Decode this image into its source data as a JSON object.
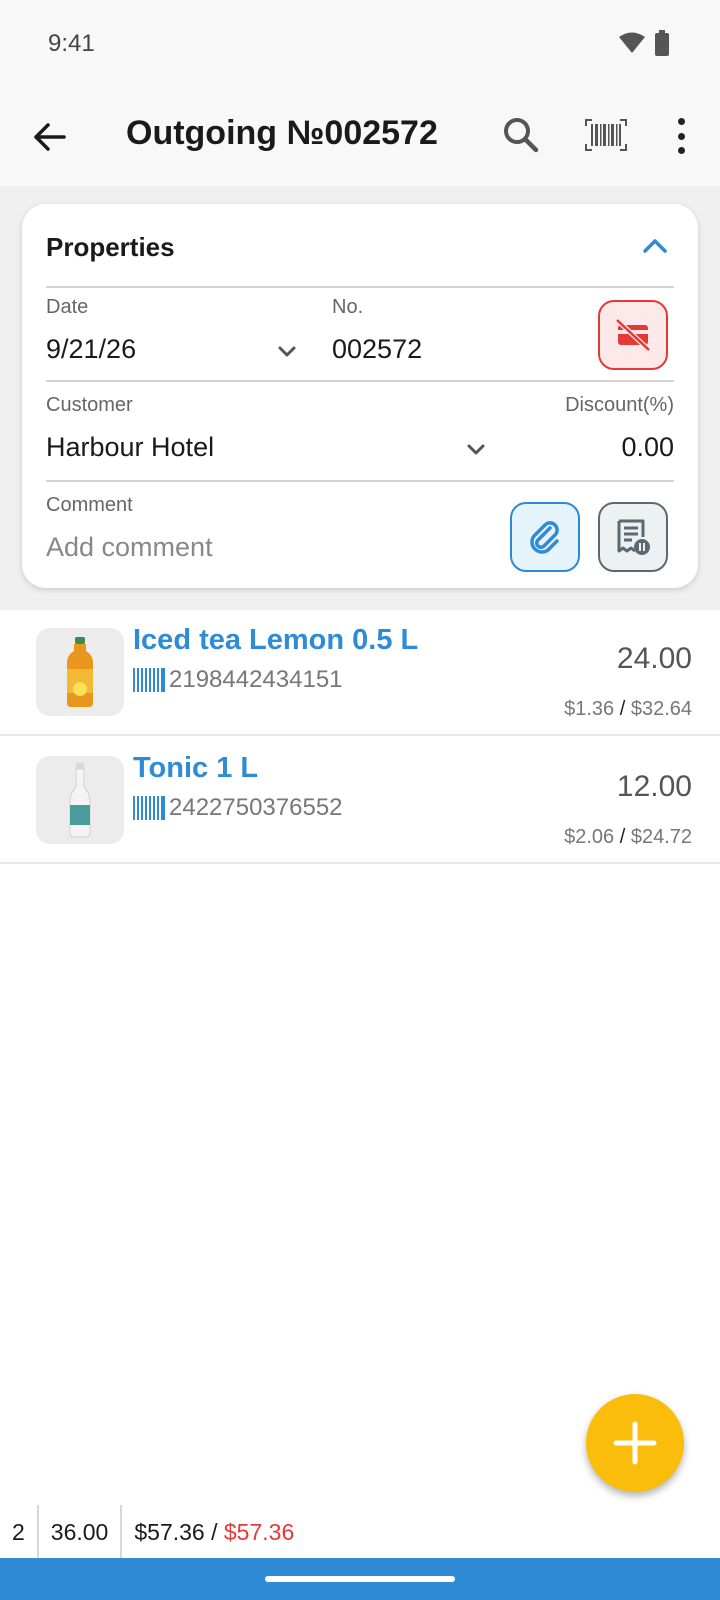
{
  "status_bar": {
    "time": "9:41",
    "icons": [
      "wifi-icon",
      "battery-icon"
    ]
  },
  "app_bar": {
    "title": "Outgoing №002572",
    "icons": [
      "back-arrow-icon",
      "search-icon",
      "barcode-scan-icon",
      "more-vert-icon"
    ]
  },
  "properties": {
    "title": "Properties",
    "date_label": "Date",
    "date_value": "9/21/26",
    "number_label": "No.",
    "number_value": "002572",
    "customer_label": "Customer",
    "customer_value": "Harbour Hotel",
    "discount_label": "Discount(%)",
    "discount_value": "0.00",
    "comment_label": "Comment",
    "comment_placeholder": "Add comment"
  },
  "items": [
    {
      "name": "Iced tea Lemon 0.5 L",
      "barcode": "2198442434151",
      "qty": "24.00",
      "unit_price": "$1.36",
      "total": "$32.64",
      "thumb_icon": "iced-tea-bottle-icon"
    },
    {
      "name": "Tonic 1 L",
      "barcode": "2422750376552",
      "qty": "12.00",
      "unit_price": "$2.06",
      "total": "$24.72",
      "thumb_icon": "tonic-bottle-icon"
    }
  ],
  "footer": {
    "count": "2",
    "qty_total": "36.00",
    "sum": "$57.36",
    "separator": "/",
    "paid": "$57.36"
  },
  "colors": {
    "accent": "#2f8bd6",
    "fab": "#fbbd0c",
    "danger": "#e53935"
  }
}
